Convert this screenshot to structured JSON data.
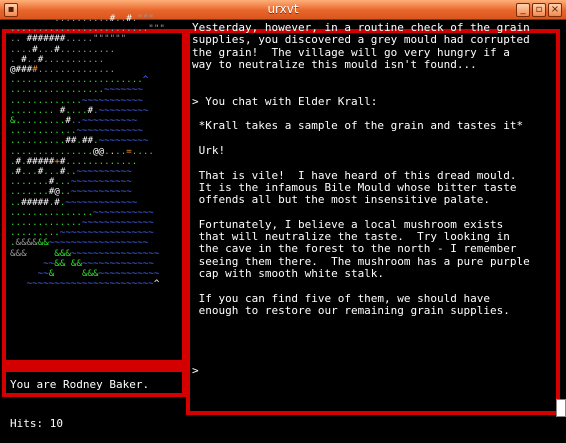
{
  "window": {
    "title": "urxvt",
    "menu_glyph": "▪",
    "minimize_glyph": "_",
    "maximize_glyph": "▫",
    "close_glyph": "×"
  },
  "map_rows": [
    [
      {
        "t": "        ..........",
        "c": "d"
      },
      {
        "t": "#",
        "c": "w"
      },
      {
        "t": "..",
        "c": "d"
      },
      {
        "t": "#",
        "c": "w"
      },
      {
        "t": ".\"\"\"",
        "c": "d"
      }
    ],
    [
      {
        "t": ".........................\"\"\"",
        "c": "d"
      }
    ],
    [
      {
        "t": ".. ",
        "c": "d"
      },
      {
        "t": "#######",
        "c": "w"
      },
      {
        "t": ".....\"\"\"\"\"\"",
        "c": "d"
      }
    ],
    [
      {
        "t": "....",
        "c": "d"
      },
      {
        "t": "#",
        "c": "w"
      },
      {
        "t": "...",
        "c": "d"
      },
      {
        "t": "#",
        "c": "w"
      },
      {
        "t": "..........",
        "c": "d"
      }
    ],
    [
      {
        "t": ". ",
        "c": "d"
      },
      {
        "t": "#",
        "c": "w"
      },
      {
        "t": "..",
        "c": "d"
      },
      {
        "t": "#",
        "c": "w"
      },
      {
        "t": "...........",
        "c": "d"
      }
    ],
    [
      {
        "t": "@###",
        "c": "w"
      },
      {
        "t": "#",
        "c": "o"
      },
      {
        "t": "..............",
        "c": "d"
      }
    ],
    [
      {
        "t": "........................",
        "c": "g"
      },
      {
        "t": "^",
        "c": "b"
      }
    ],
    [
      {
        "t": ".................",
        "c": "g"
      },
      {
        "t": "~~~~~~~",
        "c": "b"
      }
    ],
    [
      {
        "t": ".............",
        "c": "g"
      },
      {
        "t": "~~~~~~~~~~~",
        "c": "b"
      }
    ],
    [
      {
        "t": "........ ",
        "c": "g"
      },
      {
        "t": "#",
        "c": "w"
      },
      {
        "t": "....",
        "c": "g"
      },
      {
        "t": "#",
        "c": "w"
      },
      {
        "t": ".~~~~~~~~~",
        "c": "b"
      }
    ],
    [
      {
        "t": "&",
        "c": "g"
      },
      {
        "t": ".........",
        "c": "g"
      },
      {
        "t": "#",
        "c": "w"
      },
      {
        "t": "..~~~~~~~~~~",
        "c": "b"
      }
    ],
    [
      {
        "t": "............",
        "c": "g"
      },
      {
        "t": "~~~~~~~~~~~~",
        "c": "b"
      }
    ],
    [
      {
        "t": "..........",
        "c": "g"
      },
      {
        "t": "##",
        "c": "w"
      },
      {
        "t": ".",
        "c": "g"
      },
      {
        "t": "##",
        "c": "w"
      },
      {
        "t": ".",
        "c": "g"
      },
      {
        "t": "~~~~~~~~~",
        "c": "b"
      }
    ],
    [
      {
        "t": "...............",
        "c": "g"
      },
      {
        "t": "@@",
        "c": "w"
      },
      {
        "t": ".",
        "c": "g"
      },
      {
        "t": ".",
        "c": "y"
      },
      {
        "t": "..",
        "c": "g"
      },
      {
        "t": "=",
        "c": "o"
      },
      {
        "t": "....",
        "c": "g"
      }
    ],
    [
      {
        "t": ".",
        "c": "g"
      },
      {
        "t": "#",
        "c": "w"
      },
      {
        "t": ".",
        "c": "g"
      },
      {
        "t": "#####",
        "c": "w"
      },
      {
        "t": "+",
        "c": "o"
      },
      {
        "t": "#",
        "c": "w"
      },
      {
        "t": ".............",
        "c": "g"
      }
    ],
    [
      {
        "t": ".",
        "c": "g"
      },
      {
        "t": "#",
        "c": "w"
      },
      {
        "t": "...",
        "c": "g"
      },
      {
        "t": "#",
        "c": "w"
      },
      {
        "t": "...",
        "c": "g"
      },
      {
        "t": "#",
        "c": "w"
      },
      {
        "t": "..",
        "c": "g"
      },
      {
        "t": "~~~~~~~~~~",
        "c": "b"
      }
    ],
    [
      {
        "t": ".......",
        "c": "g"
      },
      {
        "t": "#",
        "c": "w"
      },
      {
        "t": "...",
        "c": "g"
      },
      {
        "t": "~~~~~~~~~~~",
        "c": "b"
      }
    ],
    [
      {
        "t": ".......",
        "c": "g"
      },
      {
        "t": "#",
        "c": "w"
      },
      {
        "t": "@",
        "c": "w"
      },
      {
        "t": "..",
        "c": "g"
      },
      {
        "t": "~~~~~~~~~~~",
        "c": "b"
      }
    ],
    [
      {
        "t": "..",
        "c": "g"
      },
      {
        "t": "#####",
        "c": "w"
      },
      {
        "t": ".",
        "c": "g"
      },
      {
        "t": "#",
        "c": "w"
      },
      {
        "t": ".",
        "c": "g"
      },
      {
        "t": "~~~~~~~~~~~~~",
        "c": "b"
      }
    ],
    [
      {
        "t": "...............",
        "c": "g"
      },
      {
        "t": "~~~~~~~~~~~",
        "c": "b"
      }
    ],
    [
      {
        "t": ".............",
        "c": "g"
      },
      {
        "t": "~~~~~~~~~~~~~",
        "c": "b"
      }
    ],
    [
      {
        "t": ".........",
        "c": "g"
      },
      {
        "t": "~~~~~~~~~~~~~~~~~",
        "c": "b"
      }
    ],
    [
      {
        "t": ".",
        "c": "g"
      },
      {
        "t": "&&&&",
        "c": "d"
      },
      {
        "t": "&&",
        "c": "g"
      },
      {
        "t": "~~~~~~~~~~~~~~~~~~",
        "c": "b"
      }
    ],
    [
      {
        "t": "&&&",
        "c": "d"
      },
      {
        "t": "     ",
        "c": "d"
      },
      {
        "t": "&&&",
        "c": "g"
      },
      {
        "t": "~~~~~~~~~~~~~~~~",
        "c": "b"
      }
    ],
    [
      {
        "t": "      ",
        "c": "d"
      },
      {
        "t": "~~",
        "c": "b"
      },
      {
        "t": "&&",
        "c": "g"
      },
      {
        "t": " ",
        "c": "d"
      },
      {
        "t": "&&",
        "c": "g"
      },
      {
        "t": "~~~~~~~~~~~~~",
        "c": "b"
      }
    ],
    [
      {
        "t": "     ",
        "c": "d"
      },
      {
        "t": "~~",
        "c": "b"
      },
      {
        "t": "&",
        "c": "g"
      },
      {
        "t": "     ",
        "c": "d"
      },
      {
        "t": "&&&",
        "c": "g"
      },
      {
        "t": "~~~~~~~~~~~",
        "c": "b"
      }
    ],
    [
      {
        "t": "   ",
        "c": "d"
      },
      {
        "t": "~~~~~~~~~~~~~~~~~~~~~~~",
        "c": "b"
      },
      {
        "t": "^",
        "c": "w"
      }
    ]
  ],
  "status": {
    "line1": "You are Rodney Baker.",
    "line2": "Hits: 10"
  },
  "messages": [
    "Yesterday, however, in a routine check of the grain",
    "supplies, you discovered a grey mould had corrupted",
    "the grain!  The village will go very hungry if a",
    "way to neutralize this mould isn't found...",
    "",
    "",
    "> You chat with Elder Krall:",
    "",
    " *Krall takes a sample of the grain and tastes it*",
    "",
    " Urk!",
    "",
    " That is vile!  I have heard of this dread mould.",
    " It is the infamous Bile Mould whose bitter taste",
    " offends all but the most insensitive palate.",
    "",
    " Fortunately, I believe a local mushroom exists",
    " that will neutralize the taste.  Try looking in",
    " the cave in the forest to the north - I remember",
    " seeing them there.  The mushroom has a pure purple",
    " cap with smooth white stalk.",
    "",
    " If you can find five of them, we should have",
    " enough to restore our remaining grain supplies."
  ],
  "prompt": ">"
}
